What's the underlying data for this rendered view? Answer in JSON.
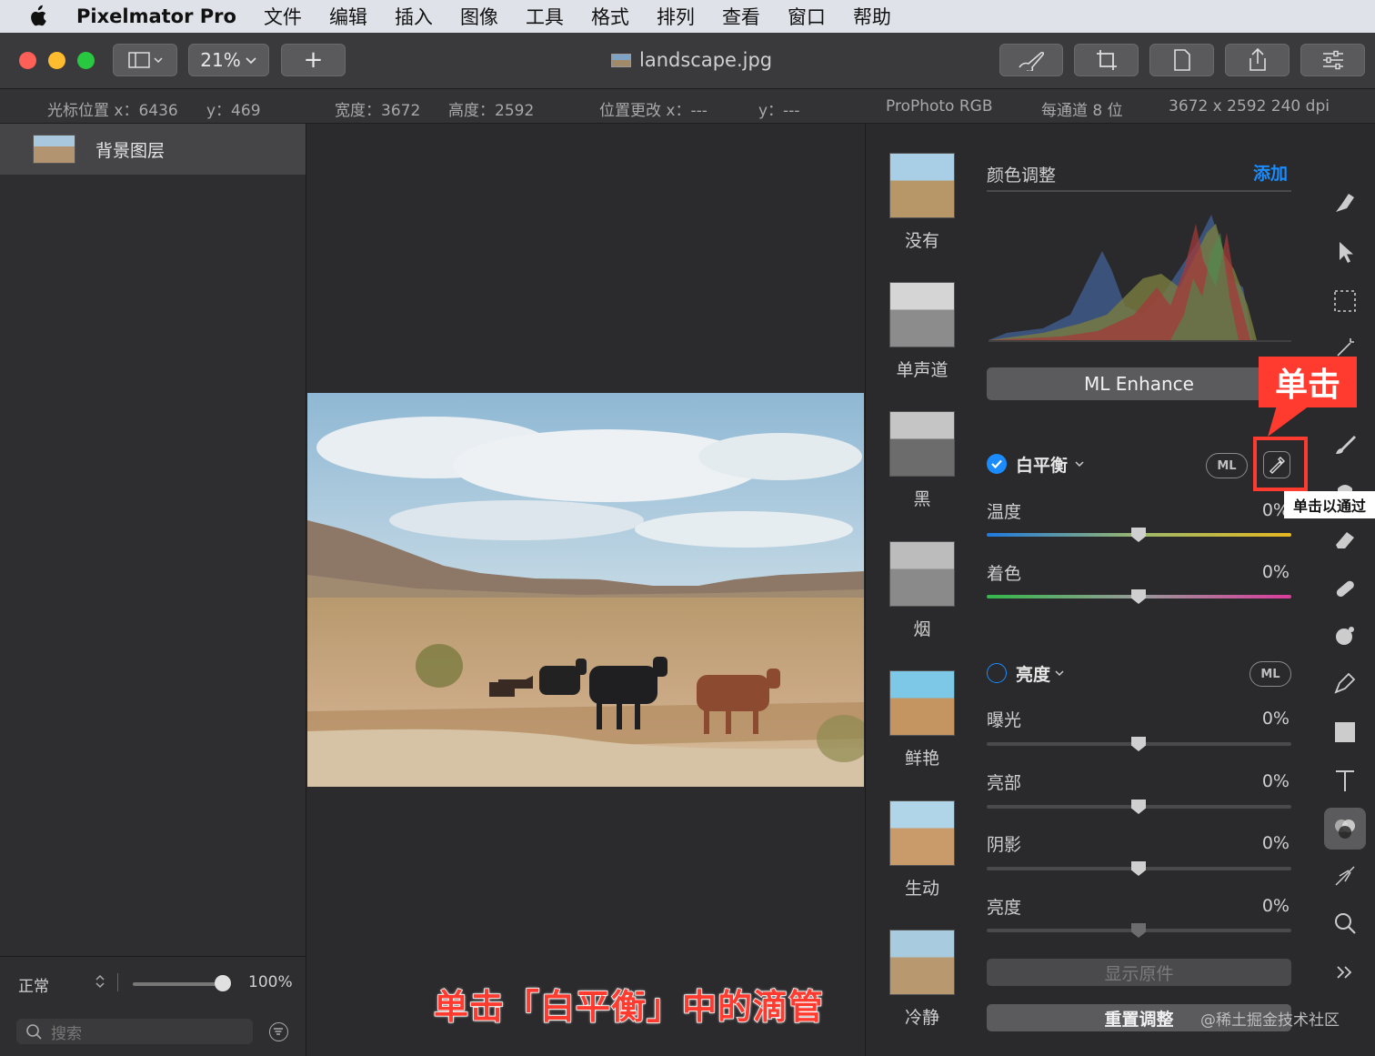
{
  "menubar": {
    "app_name": "Pixelmator Pro",
    "items": [
      "文件",
      "编辑",
      "插入",
      "图像",
      "工具",
      "格式",
      "排列",
      "查看",
      "窗口",
      "帮助"
    ]
  },
  "toolbar": {
    "zoom": "21%",
    "add_label": "+",
    "document_title": "landscape.jpg"
  },
  "infobar": {
    "cursor_x": "光标位置 x：6436",
    "cursor_y": "y：469",
    "width": "宽度：3672",
    "height": "高度：2592",
    "pos_change_x": "位置更改 x：---",
    "pos_change_y": "y：---",
    "color_profile": "ProPhoto RGB",
    "bit_depth": "每通道 8 位",
    "dimensions": "3672 x 2592 240 dpi"
  },
  "layers": {
    "layer_name": "背景图层",
    "blend_mode": "正常",
    "opacity": "100%",
    "search_placeholder": "搜索"
  },
  "presets": [
    {
      "label": "没有"
    },
    {
      "label": "单声道"
    },
    {
      "label": "黑"
    },
    {
      "label": "烟"
    },
    {
      "label": "鲜艳"
    },
    {
      "label": "生动"
    },
    {
      "label": "冷静"
    }
  ],
  "adjust": {
    "section_title": "颜色调整",
    "add_label": "添加",
    "ml_enhance": "ML Enhance",
    "white_balance": {
      "title": "白平衡",
      "ml": "ML",
      "temperature_label": "温度",
      "temperature_value": "0%",
      "tint_label": "着色",
      "tint_value": "0%"
    },
    "brightness": {
      "title": "亮度",
      "ml": "ML",
      "exposure_label": "曝光",
      "exposure_value": "0%",
      "highlights_label": "亮部",
      "highlights_value": "0%",
      "shadows_label": "阴影",
      "shadows_value": "0%",
      "brightness_label": "亮度",
      "brightness_value": "0%"
    },
    "show_original": "显示原件",
    "reset": "重置调整"
  },
  "annotations": {
    "callout": "单击",
    "tooltip": "单击以通过",
    "caption": "单击「白平衡」中的滴管",
    "watermark": "@稀土掘金技术社区"
  },
  "colors": {
    "accent_blue": "#1a8cff",
    "annotation_red": "#ff3b30"
  }
}
